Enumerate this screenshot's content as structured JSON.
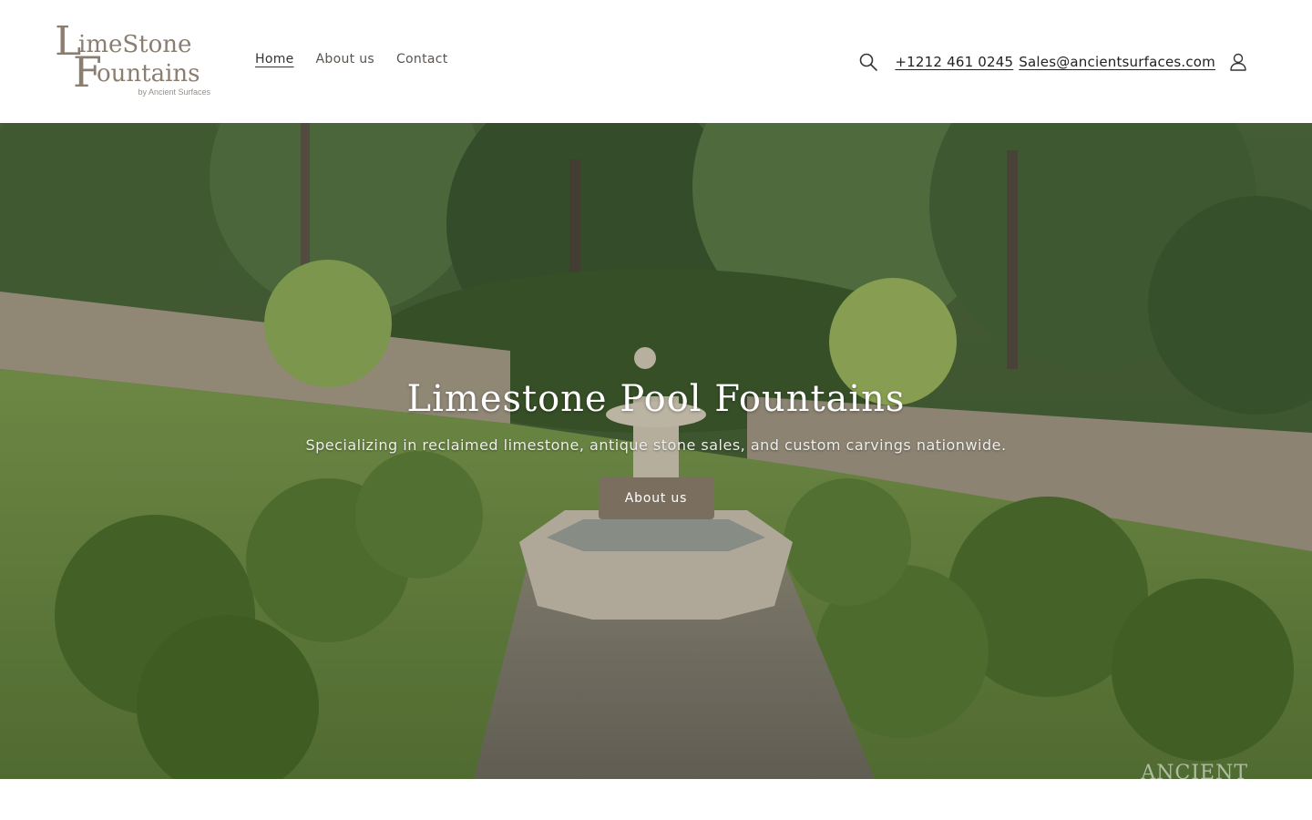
{
  "brand": {
    "logo_line1_cap": "L",
    "logo_line1_rest": "imeStone",
    "logo_line2_cap": "F",
    "logo_line2_rest": "ountains",
    "logo_sub": "by Ancient Surfaces",
    "logo_color": "#8a7e70"
  },
  "nav": {
    "items": [
      {
        "label": "Home",
        "active": true
      },
      {
        "label": "About us",
        "active": false
      },
      {
        "label": "Contact",
        "active": false
      }
    ]
  },
  "header_right": {
    "search_icon": "search-icon",
    "phone": "+1212 461 0245",
    "email": "Sales@ancientsurfaces.com",
    "account_icon": "account-icon"
  },
  "hero": {
    "title": "Limestone Pool Fountains",
    "subtitle": "Specializing in reclaimed limestone, antique stone sales, and custom carvings nationwide.",
    "button_label": "About us",
    "button_color": "#7a6e5f",
    "watermark": "ANCIENT"
  }
}
